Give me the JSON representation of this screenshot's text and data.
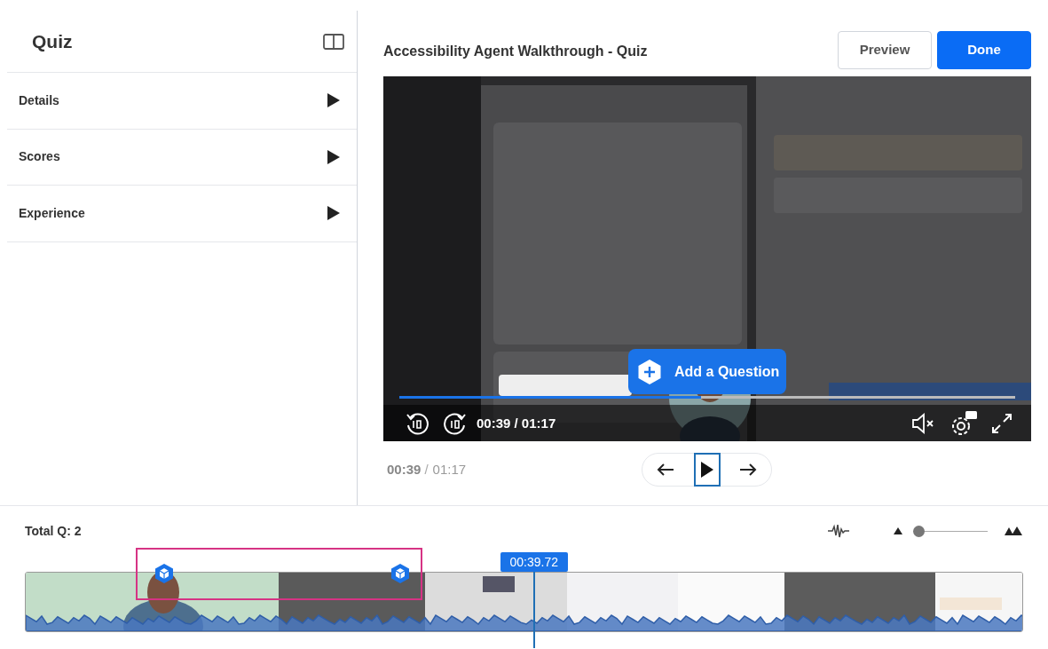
{
  "sidebar": {
    "title": "Quiz",
    "items": [
      {
        "label": "Details",
        "expanded": false
      },
      {
        "label": "Scores",
        "expanded": false
      },
      {
        "label": "Experience",
        "expanded": false
      }
    ]
  },
  "header": {
    "title": "Accessibility Agent Walkthrough - Quiz",
    "buttons": [
      {
        "label": "Preview",
        "kind": "secondary"
      },
      {
        "label": "Done",
        "kind": "primary"
      }
    ]
  },
  "player": {
    "overlay_button": "Add a Question",
    "progress": {
      "level": 0.49
    },
    "time": "00:39 / 01:17",
    "muted": true
  },
  "playback_time": {
    "current": "00:39",
    "separator": "/",
    "total": "01:17"
  },
  "timeline": {
    "total": "Total Q: 2",
    "zoom": {
      "level": 0.0
    },
    "playhead": {
      "time": "00:39.72",
      "level": 0.51
    }
  }
}
